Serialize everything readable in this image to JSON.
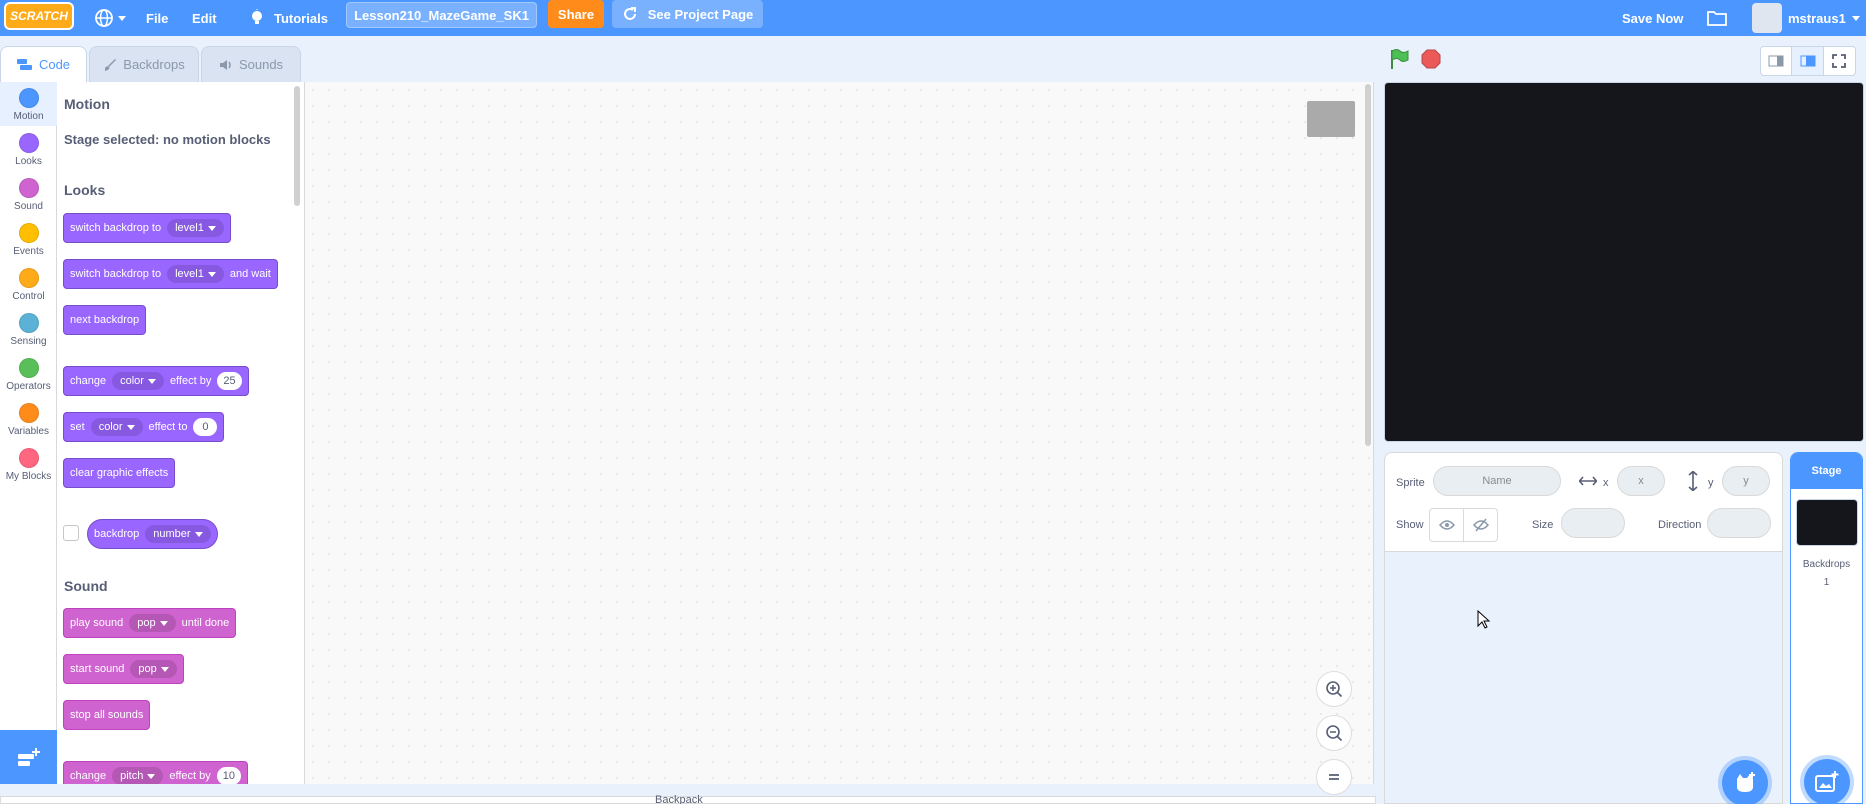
{
  "menubar": {
    "logo": "SCRATCH",
    "file": "File",
    "edit": "Edit",
    "tutorials": "Tutorials",
    "project_title": "Lesson210_MazeGame_SK1",
    "share": "Share",
    "see_project_page": "See Project Page",
    "save_now": "Save Now",
    "username": "mstraus1"
  },
  "tabs": {
    "code": "Code",
    "backdrops": "Backdrops",
    "sounds": "Sounds"
  },
  "categories": [
    {
      "label": "Motion",
      "color": "#4c97ff"
    },
    {
      "label": "Looks",
      "color": "#9966ff"
    },
    {
      "label": "Sound",
      "color": "#cf63cf"
    },
    {
      "label": "Events",
      "color": "#ffbf00"
    },
    {
      "label": "Control",
      "color": "#ffab19"
    },
    {
      "label": "Sensing",
      "color": "#5cb1d6"
    },
    {
      "label": "Operators",
      "color": "#59c059"
    },
    {
      "label": "Variables",
      "color": "#ff8c1a"
    },
    {
      "label": "My Blocks",
      "color": "#ff6680"
    }
  ],
  "palette": {
    "motion_header": "Motion",
    "motion_note": "Stage selected: no motion blocks",
    "looks_header": "Looks",
    "sound_header": "Sound",
    "looks_blocks": {
      "switch_backdrop": {
        "text": "switch backdrop to",
        "value": "level1"
      },
      "switch_backdrop_wait": {
        "text": "switch backdrop to",
        "value": "level1",
        "suffix": "and wait"
      },
      "next_backdrop": "next backdrop",
      "change_effect": {
        "text": "change",
        "effect": "color",
        "mid": "effect by",
        "value": "25"
      },
      "set_effect": {
        "text": "set",
        "effect": "color",
        "mid": "effect to",
        "value": "0"
      },
      "clear_effects": "clear graphic effects",
      "backdrop_reporter": {
        "text": "backdrop",
        "value": "number"
      }
    },
    "sound_blocks": {
      "play_sound": {
        "text": "play sound",
        "value": "pop",
        "suffix": "until done"
      },
      "start_sound": {
        "text": "start sound",
        "value": "pop"
      },
      "stop_all": "stop all sounds",
      "change_pitch": {
        "text": "change",
        "effect": "pitch",
        "mid": "effect by",
        "value": "10"
      }
    }
  },
  "backpack": "Backpack",
  "sprite_info": {
    "sprite_label": "Sprite",
    "name_placeholder": "Name",
    "x_label": "x",
    "x_placeholder": "x",
    "y_label": "y",
    "y_placeholder": "y",
    "show_label": "Show",
    "size_label": "Size",
    "direction_label": "Direction"
  },
  "stage_panel": {
    "title": "Stage",
    "backdrops_label": "Backdrops",
    "backdrops_count": "1"
  }
}
